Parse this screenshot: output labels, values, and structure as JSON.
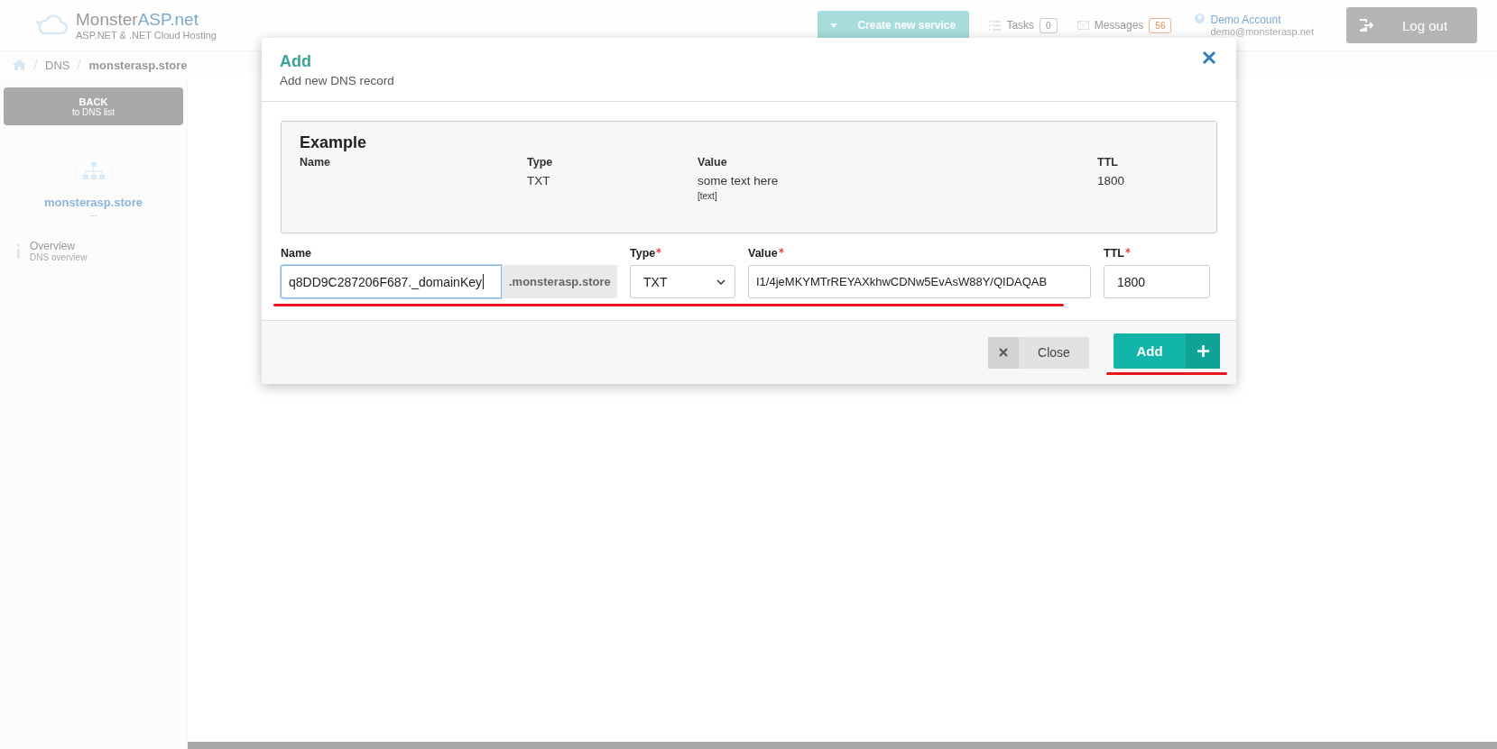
{
  "header": {
    "logo": {
      "part_1": "Monster",
      "part_2": "ASP",
      "part_3": ".net",
      "tagline": "ASP.NET & .NET Cloud Hosting"
    },
    "create_button": "Create new service",
    "tasks": {
      "label": "Tasks",
      "count": "0"
    },
    "messages": {
      "label": "Messages",
      "count": "56"
    },
    "account": {
      "name": "Demo Account",
      "email": "demo@monsterasp.net"
    },
    "logout": "Log out"
  },
  "breadcrumb": [
    "DNS",
    "monsterasp.store"
  ],
  "sidebar": {
    "back": {
      "label": "BACK",
      "sublabel": "to DNS list"
    },
    "domain": "monsterasp.store",
    "domain_note": "...",
    "items": [
      {
        "label": "Overview",
        "sublabel": "DNS overview"
      }
    ]
  },
  "dialog": {
    "title": "Add",
    "subtitle": "Add new DNS record",
    "example": {
      "heading": "Example",
      "columns": [
        "Name",
        "Type",
        "Value",
        "TTL"
      ],
      "row": {
        "type": "TXT",
        "value": "some text here",
        "value_note": "[text]",
        "ttl": "1800"
      }
    },
    "fields": [
      {
        "kind": "text",
        "label": "Name",
        "required": false,
        "value": "q8DD9C287206F687._domainKey",
        "suffix": ".monsterasp.store",
        "focused": true
      },
      {
        "kind": "select",
        "label": "Type",
        "required": true,
        "value": "TXT",
        "focused": false
      },
      {
        "kind": "text",
        "label": "Value",
        "required": true,
        "value": "I1/4jeMKYMTrREYAXkhwCDNw5EvAsW88Y/QIDAQAB",
        "focused": false
      },
      {
        "kind": "text",
        "label": "TTL",
        "required": true,
        "value": "1800",
        "focused": false
      }
    ],
    "buttons": [
      {
        "kind": "close",
        "label": "Close"
      },
      {
        "kind": "add",
        "label": "Add"
      }
    ]
  }
}
